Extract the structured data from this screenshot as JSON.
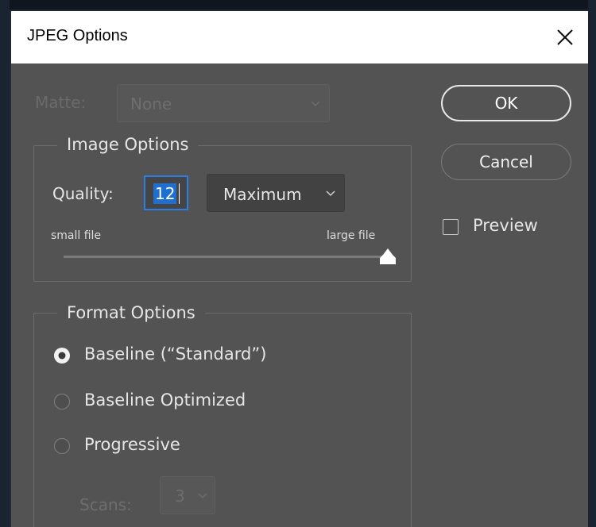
{
  "dialog": {
    "title": "JPEG Options",
    "close_icon": "close-icon"
  },
  "matte": {
    "label": "Matte:",
    "value": "None"
  },
  "image_options": {
    "legend": "Image Options",
    "quality_label": "Quality:",
    "quality_value": "12",
    "quality_preset": "Maximum",
    "slider_min_label": "small file",
    "slider_max_label": "large file",
    "slider_value": 12,
    "slider_max": 12
  },
  "format_options": {
    "legend": "Format Options",
    "options": [
      {
        "label": "Baseline (“Standard”)",
        "selected": true
      },
      {
        "label": "Baseline Optimized",
        "selected": false
      },
      {
        "label": "Progressive",
        "selected": false
      }
    ],
    "scans_label": "Scans:",
    "scans_value": "3"
  },
  "buttons": {
    "ok": "OK",
    "cancel": "Cancel"
  },
  "preview": {
    "label": "Preview",
    "checked": false
  },
  "colors": {
    "dialog_bg": "#535353",
    "title_bg": "#ffffff",
    "focus_blue": "#2d7ee2",
    "selection_blue": "#1f6fd1",
    "disabled_text": "#6e6e6e",
    "text": "#e6e6e6"
  }
}
